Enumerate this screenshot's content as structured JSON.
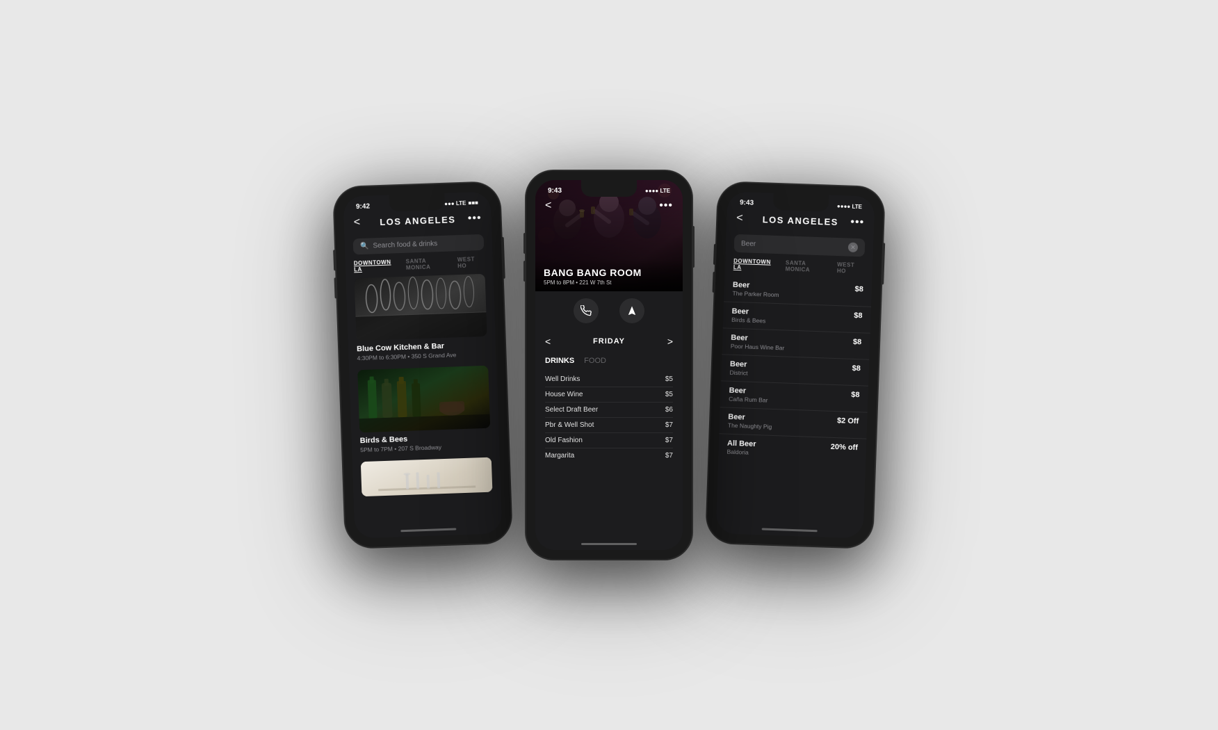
{
  "background": "#e8e8e8",
  "phones": [
    {
      "id": "phone-left",
      "statusBar": {
        "time": "9:42",
        "signal": "●●●● LTE",
        "battery": "■■■"
      },
      "nav": {
        "back": "<",
        "title": "LOS ANGELES",
        "dots": "•••"
      },
      "search": {
        "placeholder": "Search food & drinks"
      },
      "filters": [
        "DOWNTOWN LA",
        "SANTA MONICA",
        "WEST HO"
      ],
      "venues": [
        {
          "name": "Blue Cow Kitchen & Bar",
          "info": "4:30PM to 6:30PM • 350 S Grand Ave",
          "imageType": "bar-glasses"
        },
        {
          "name": "Birds & Bees",
          "info": "5PM to 7PM • 207 S Broadway",
          "imageType": "bottles"
        },
        {
          "name": "",
          "info": "",
          "imageType": "light"
        }
      ]
    },
    {
      "id": "phone-center",
      "statusBar": {
        "time": "9:43",
        "signal": "●●●● LTE",
        "battery": "■■■"
      },
      "nav": {
        "back": "<",
        "title": "",
        "dots": "•••"
      },
      "hero": {
        "name": "BANG BANG ROOM",
        "hours": "5PM to 8PM",
        "address": "221 W 7th St"
      },
      "actions": {
        "phone": "📞",
        "directions": "◆"
      },
      "dayNav": {
        "prev": "<",
        "label": "FRIDAY",
        "next": ">"
      },
      "menuTabs": [
        "DRINKS",
        "FOOD"
      ],
      "menuItems": [
        {
          "name": "Well Drinks",
          "price": "$5"
        },
        {
          "name": "House Wine",
          "price": "$5"
        },
        {
          "name": "Select Draft Beer",
          "price": "$6"
        },
        {
          "name": "Pbr & Well Shot",
          "price": "$7"
        },
        {
          "name": "Old Fashion",
          "price": "$7"
        },
        {
          "name": "Margarita",
          "price": "$7"
        }
      ]
    },
    {
      "id": "phone-right",
      "statusBar": {
        "time": "9:43",
        "signal": "●●●● LTE",
        "battery": "■■■"
      },
      "nav": {
        "back": "<",
        "title": "LOS ANGELES",
        "dots": "•••"
      },
      "search": {
        "value": "Beer",
        "showClear": true
      },
      "filters": [
        "DOWNTOWN LA",
        "SANTA MONICA",
        "WEST HO"
      ],
      "results": [
        {
          "name": "Beer",
          "venue": "The Parker Room",
          "price": "$8"
        },
        {
          "name": "Beer",
          "venue": "Birds & Bees",
          "price": "$8"
        },
        {
          "name": "Beer",
          "venue": "Poor Haus Wine Bar",
          "price": "$8"
        },
        {
          "name": "Beer",
          "venue": "District",
          "price": "$8"
        },
        {
          "name": "Beer",
          "venue": "Caña Rum Bar",
          "price": "$8"
        },
        {
          "name": "Beer",
          "venue": "The Naughty Pig",
          "price": "$2 Off"
        },
        {
          "name": "All Beer",
          "venue": "Baldoria",
          "price": "20% off"
        }
      ]
    }
  ]
}
